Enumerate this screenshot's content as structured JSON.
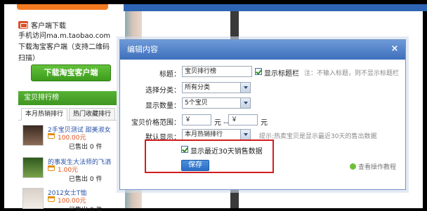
{
  "sidebar": {
    "client_title": "客户端下载",
    "client_desc": "手机访问ma.m.taobao.com 下载淘宝客户端（支持二维码 扫描）",
    "download_button": "下载淘宝客户端",
    "rank_title": "宝贝排行榜",
    "tabs": [
      "本月热销排行",
      "热门收藏排行"
    ],
    "items": [
      {
        "name": "2手宝贝测试 甜美淑女",
        "price": "100.00元",
        "sold": "已售出 0 件"
      },
      {
        "name": "的事发生大法师的飞洒",
        "price": "1.00元",
        "sold": "已售出 0 件"
      },
      {
        "name": "2012女士T恤",
        "price": "100.00元",
        "sold": "已售出 0 件"
      }
    ]
  },
  "modal": {
    "title": "编辑内容",
    "close_icon": "×",
    "title_label": "标题：",
    "title_value": "宝贝排行榜",
    "show_title_label": "显示标题栏",
    "title_hint": "注：不输入标题，则不显示标题栏",
    "category_label": "选择分类：",
    "category_value": "所有分类",
    "count_label": "显示数量：",
    "count_value": "5个宝贝",
    "price_label": "宝贝价格范围：",
    "price_from_placeholder": "￥",
    "price_to_placeholder": "￥",
    "price_unit1": "元 --",
    "price_unit2": "元",
    "default_label": "默认显示：",
    "default_value": "本月热销排行",
    "default_hint": "提示:热卖宝贝是显示最近30天的售出数据",
    "recent_sales_label": "显示最近30天销售数据",
    "save_button": "保存",
    "view_demo": "查看操作教程"
  }
}
